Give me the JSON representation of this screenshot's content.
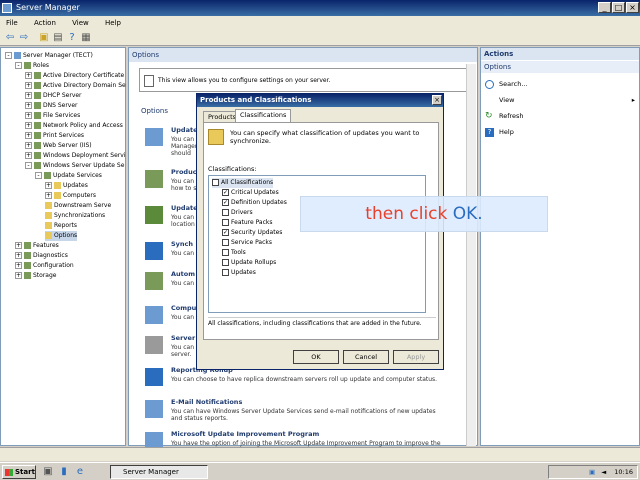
{
  "window": {
    "title": "Server Manager",
    "controls": [
      "_",
      "□",
      "×"
    ]
  },
  "menu": [
    "File",
    "Action",
    "View",
    "Help"
  ],
  "tree": [
    {
      "label": "Server Manager (TECT)",
      "indent": 0,
      "expander": "-"
    },
    {
      "label": "Roles",
      "indent": 1,
      "expander": "-"
    },
    {
      "label": "Active Directory Certificate",
      "indent": 2,
      "expander": "+"
    },
    {
      "label": "Active Directory Domain Se",
      "indent": 2,
      "expander": "+"
    },
    {
      "label": "DHCP Server",
      "indent": 2,
      "expander": "+"
    },
    {
      "label": "DNS Server",
      "indent": 2,
      "expander": "+"
    },
    {
      "label": "File Services",
      "indent": 2,
      "expander": "+"
    },
    {
      "label": "Network Policy and Access",
      "indent": 2,
      "expander": "+"
    },
    {
      "label": "Print Services",
      "indent": 2,
      "expander": "+"
    },
    {
      "label": "Web Server (IIS)",
      "indent": 2,
      "expander": "+"
    },
    {
      "label": "Windows Deployment Servi",
      "indent": 2,
      "expander": "+"
    },
    {
      "label": "Windows Server Update Se",
      "indent": 2,
      "expander": "-"
    },
    {
      "label": "Update Services",
      "indent": 3,
      "expander": "-"
    },
    {
      "label": "Updates",
      "indent": 4,
      "expander": "+"
    },
    {
      "label": "Computers",
      "indent": 4,
      "expander": "+"
    },
    {
      "label": "Downstream Serve",
      "indent": 4,
      "expander": ""
    },
    {
      "label": "Synchronizations",
      "indent": 4,
      "expander": ""
    },
    {
      "label": "Reports",
      "indent": 4,
      "expander": ""
    },
    {
      "label": "Options",
      "indent": 4,
      "expander": "",
      "selected": true
    },
    {
      "label": "Features",
      "indent": 1,
      "expander": "+"
    },
    {
      "label": "Diagnostics",
      "indent": 1,
      "expander": "+"
    },
    {
      "label": "Configuration",
      "indent": 1,
      "expander": "+"
    },
    {
      "label": "Storage",
      "indent": 1,
      "expander": "+"
    }
  ],
  "center": {
    "header": "Options",
    "info": "This view allows you to configure settings on your server.",
    "options_label": "Options",
    "items": [
      {
        "title": "Update",
        "desc": "You can\nManagem\nshould"
      },
      {
        "title": "Product",
        "desc": "You can\nhow to s"
      },
      {
        "title": "Update",
        "desc": "You can\nlocation"
      },
      {
        "title": "Synch",
        "desc": "You can"
      },
      {
        "title": "Autom",
        "desc": "You can"
      },
      {
        "title": "Compu",
        "desc": "You can"
      },
      {
        "title": "Server",
        "desc": "You can\nserver."
      },
      {
        "title": "Reporting Rollup",
        "desc": "You can choose to have replica downstream servers roll up update and computer status."
      },
      {
        "title": "E-Mail Notifications",
        "desc": "You can have Windows Server Update Services send e-mail notifications of new updates and status reports."
      },
      {
        "title": "Microsoft Update Improvement Program",
        "desc": "You have the option of joining the Microsoft Update Improvement Program to improve the"
      }
    ]
  },
  "actions": {
    "header": "Actions",
    "sub": "Options",
    "items": [
      {
        "label": "Search...",
        "icon": "search-icon"
      },
      {
        "label": "View",
        "icon": "",
        "arrow": "▸"
      },
      {
        "label": "Refresh",
        "icon": "refresh-icon"
      },
      {
        "label": "Help",
        "icon": "help-icon"
      }
    ]
  },
  "dialog": {
    "title": "Products and Classifications",
    "tabs": [
      "Products",
      "Classifications"
    ],
    "info": "You can specify what classification of updates you want to synchronize.",
    "classifications_label": "Classifications:",
    "items": [
      {
        "label": "All Classifications",
        "checked": false,
        "level": 0
      },
      {
        "label": "Critical Updates",
        "checked": true,
        "level": 1
      },
      {
        "label": "Definition Updates",
        "checked": true,
        "level": 1
      },
      {
        "label": "Drivers",
        "checked": false,
        "level": 1
      },
      {
        "label": "Feature Packs",
        "checked": false,
        "level": 1
      },
      {
        "label": "Security Updates",
        "checked": true,
        "level": 1
      },
      {
        "label": "Service Packs",
        "checked": false,
        "level": 1
      },
      {
        "label": "Tools",
        "checked": false,
        "level": 1
      },
      {
        "label": "Update Rollups",
        "checked": false,
        "level": 1
      },
      {
        "label": "Updates",
        "checked": false,
        "level": 1
      }
    ],
    "description": "All classifications, including classifications that are added in the future.",
    "buttons": {
      "ok": "OK",
      "cancel": "Cancel",
      "apply": "Apply"
    }
  },
  "callout": {
    "prefix": "then click ",
    "emphasis": "OK",
    "suffix": ".",
    "prefix_color": "#e8402a",
    "emphasis_color": "#2a6dbf"
  },
  "taskbar": {
    "start": "Start",
    "task": "Server Manager",
    "clock": "10:16"
  }
}
